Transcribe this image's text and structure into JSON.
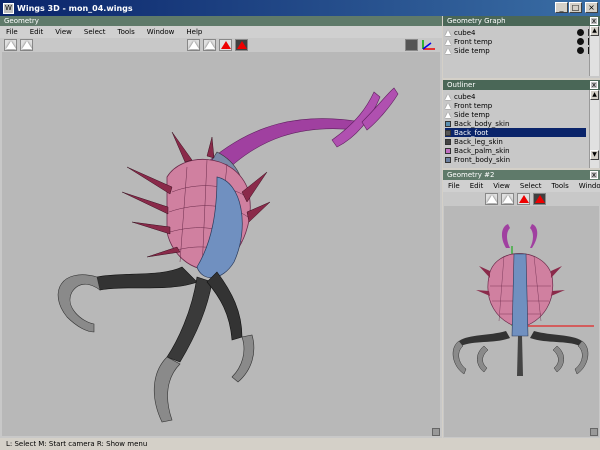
{
  "window": {
    "title": "Wings 3D - mon_04.wings",
    "app_icon": "W",
    "minimize": "_",
    "maximize": "□",
    "close": "×"
  },
  "geometry": {
    "title": "Geometry",
    "menu": [
      "File",
      "Edit",
      "View",
      "Select",
      "Tools",
      "Window",
      "Help"
    ]
  },
  "geometry_graph": {
    "title": "Geometry Graph",
    "items": [
      {
        "label": "cube4"
      },
      {
        "label": "Front temp"
      },
      {
        "label": "Side temp"
      }
    ]
  },
  "outliner": {
    "title": "Outliner",
    "items": [
      {
        "label": "cube4",
        "kind": "object",
        "color": "#ffffff"
      },
      {
        "label": "Front temp",
        "kind": "object",
        "color": "#ffffff"
      },
      {
        "label": "Side temp",
        "kind": "object",
        "color": "#ffffff"
      },
      {
        "label": "Back_body_skin",
        "kind": "material",
        "color": "#5a8fb0"
      },
      {
        "label": "Back_foot",
        "kind": "material",
        "color": "#555555",
        "selected": true
      },
      {
        "label": "Back_leg_skin",
        "kind": "material",
        "color": "#444444"
      },
      {
        "label": "Back_palm_skin",
        "kind": "material",
        "color": "#c070c0"
      },
      {
        "label": "Front_body_skin",
        "kind": "material",
        "color": "#6a7fa0"
      }
    ]
  },
  "geometry2": {
    "title": "Geometry #2",
    "menu": [
      "File",
      "Edit",
      "View",
      "Select",
      "Tools",
      "Window"
    ]
  },
  "status": {
    "text": "L: Select   M: Start camera   R: Show menu"
  },
  "colors": {
    "panel_bar": "#5f7a6a",
    "selection": "#0a246a",
    "viewport": "#b8b8b8",
    "select_red": "#e00000"
  }
}
